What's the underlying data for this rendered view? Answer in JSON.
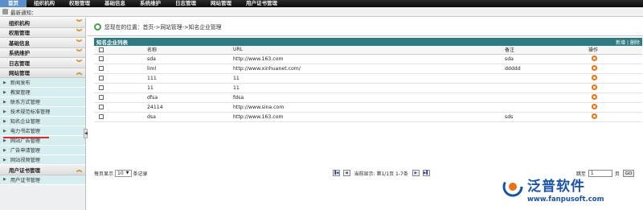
{
  "top_menu": [
    "首页",
    "组织机构",
    "权限管理",
    "基础信息",
    "系统维护",
    "日志管理",
    "网站管理",
    "用户证书管理"
  ],
  "notice_label": "最新通知：",
  "sidebar": {
    "sections": [
      {
        "label": "组织机构",
        "icon": "chevron-double-down"
      },
      {
        "label": "权限管理",
        "icon": "chevron-double-down"
      },
      {
        "label": "基础信息",
        "icon": "chevron-double-down"
      },
      {
        "label": "系统维护",
        "icon": "chevron-double-down"
      },
      {
        "label": "日志管理",
        "icon": "chevron-double-down"
      },
      {
        "label": "网站管理",
        "icon": "chevron-double-up"
      }
    ],
    "sub_items": [
      "新闻发布",
      "教案管理",
      "联系方式管理",
      "技术规范标准管理",
      "知名企业管理",
      "电力书店管理",
      "网站广告管理",
      "广告申请管理",
      "网站视频管理"
    ],
    "bottom_section": "用户证书管理",
    "bottom_sub": "用户证书管理",
    "collapse_glyph": "◀"
  },
  "location": {
    "text": "您现在的位置：首页->网站管理->知名企业管理"
  },
  "panel": {
    "title": "知名企业列表",
    "add_label": "新增",
    "separator": "|",
    "delete_label": "删除"
  },
  "table": {
    "headers": {
      "name": "名称",
      "url": "URL",
      "remark": "备注",
      "action": "操作"
    },
    "rows": [
      {
        "name": "sda",
        "url": "http://www.163.com",
        "remark": "sda"
      },
      {
        "name": "liml",
        "url": "http://www.xinhuanet.com/",
        "remark": "ddddd"
      },
      {
        "name": "111",
        "url": "11",
        "remark": ""
      },
      {
        "name": "11",
        "url": "11",
        "remark": ""
      },
      {
        "name": "dfsa",
        "url": "fdsa",
        "remark": ""
      },
      {
        "name": "24114",
        "url": "http://www.sina.com",
        "remark": ""
      },
      {
        "name": "dsa",
        "url": "http://www.163.com",
        "remark": "sds"
      }
    ]
  },
  "pager": {
    "per_page_prefix": "每页显示",
    "per_page_value": "10",
    "per_page_suffix": "条记录",
    "status": "当前显示: 第1/1页 1-7条",
    "jump_label": "跳至",
    "jump_value": "1",
    "page_unit": "页",
    "go_label": "GO"
  },
  "watermark": {
    "brand": "泛普软件",
    "url": "www.fanpusoft.com"
  },
  "colors": {
    "panel_header": "#2e7a83",
    "sidebar_sub": "#d7eef0",
    "action_icon": "#e87215",
    "brand": "#1a53a5"
  }
}
